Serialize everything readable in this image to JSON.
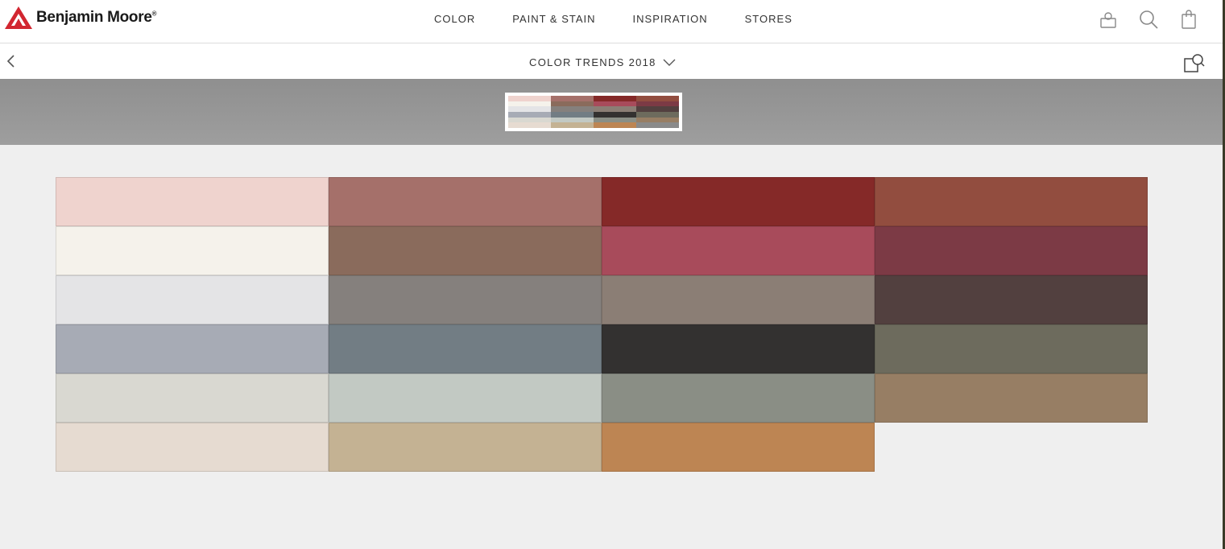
{
  "brand": {
    "name": "Benjamin Moore",
    "reg": "®",
    "logo_color": "#d22630"
  },
  "nav": {
    "items": [
      {
        "label": "COLOR"
      },
      {
        "label": "PAINT & STAIN"
      },
      {
        "label": "INSPIRATION"
      },
      {
        "label": "STORES"
      }
    ]
  },
  "header_icons": [
    "account-icon",
    "search-icon",
    "cart-icon"
  ],
  "subheader": {
    "title": "COLOR TRENDS 2018"
  },
  "palette": {
    "colors": [
      "#efd3ce",
      "#a5706a",
      "#852928",
      "#924d3f",
      "#f5f2eb",
      "#8a6b5c",
      "#a84b5b",
      "#7c3a45",
      "#e4e4e6",
      "#85807d",
      "#8b7e75",
      "#52403f",
      "#a7abb5",
      "#727d84",
      "#333130",
      "#6d6b5d",
      "#d9d8d1",
      "#c2c9c3",
      "#8a8e85",
      "#977e64",
      "#e6dbd1",
      "#c4b293",
      "#bd8553",
      null
    ]
  }
}
